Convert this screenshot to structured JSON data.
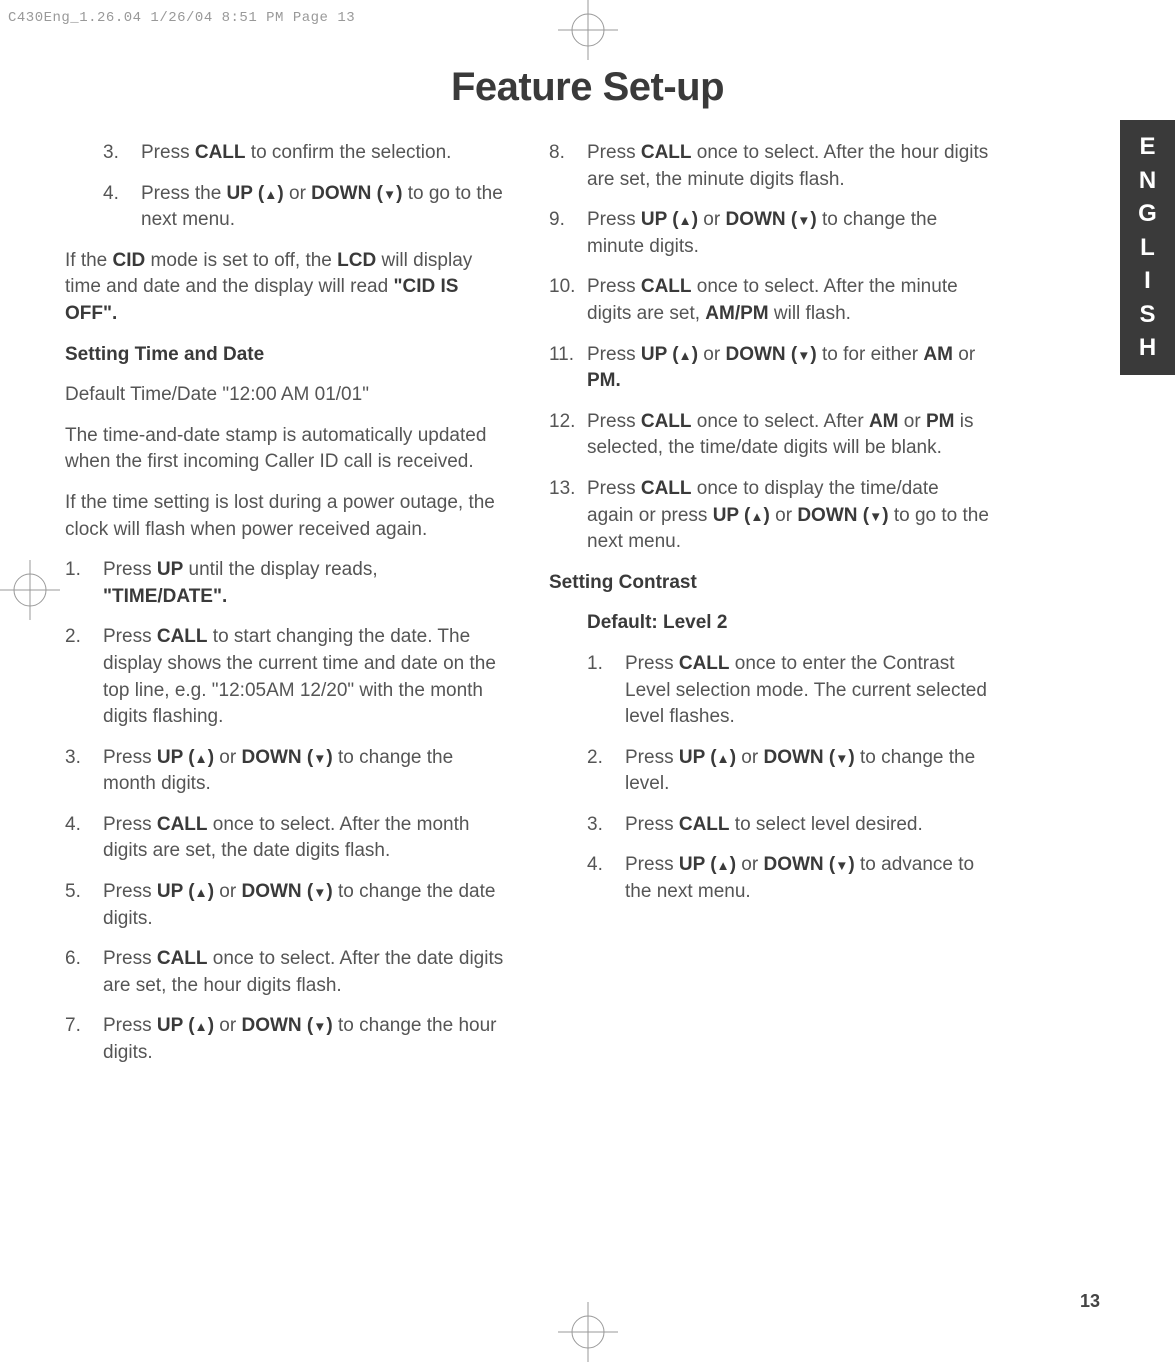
{
  "header_print": "C430Eng_1.26.04  1/26/04  8:51 PM  Page 13",
  "title": "Feature Set-up",
  "side_tab": [
    "E",
    "N",
    "G",
    "L",
    "I",
    "S",
    "H"
  ],
  "page_number": "13",
  "left": {
    "li3_num": "3.",
    "li3_a": "Press ",
    "li3_b": "CALL",
    "li3_c": " to confirm the selection.",
    "li4_num": "4.",
    "li4_a": "Press the ",
    "li4_b": "UP (",
    "li4_c": ")",
    "li4_d": " or ",
    "li4_e": "DOWN (",
    "li4_f": ")",
    "li4_g": " to go to the next menu.",
    "p1_a": "If the ",
    "p1_b": "CID",
    "p1_c": " mode is set to off, the ",
    "p1_d": "LCD",
    "p1_e": " will display time and date and the display will read ",
    "p1_f": "\"CID IS OFF\".",
    "h1": "Setting Time and Date",
    "p2": "Default Time/Date \"12:00 AM 01/01\"",
    "p3": "The time-and-date stamp is automatically updated when the first incoming Caller ID call is received.",
    "p4": "If the time setting is lost during a power outage, the clock will flash when power received  again.",
    "s1_num": "1.",
    "s1_a": "Press ",
    "s1_b": "UP",
    "s1_c": " until the display reads, ",
    "s1_d": "\"TIME/DATE\".",
    "s2_num": "2.",
    "s2_a": "Press ",
    "s2_b": "CALL",
    "s2_c": " to start changing the date. The display shows the current time and date on the top line, e.g. \"12:05AM 12/20\" with the month digits flashing.",
    "s3_num": "3.",
    "s3_a": "Press ",
    "s3_b": "UP (",
    "s3_c": ")",
    "s3_d": " or ",
    "s3_e": "DOWN (",
    "s3_f": ")",
    "s3_g": " to change the  month digits.",
    "s4_num": "4.",
    "s4_a": "Press ",
    "s4_b": "CALL",
    "s4_c": " once to select. After the month digits are set, the date digits flash.",
    "s5_num": "5.",
    "s5_a": "Press ",
    "s5_b": "UP (",
    "s5_c": ")",
    "s5_d": " or ",
    "s5_e": "DOWN (",
    "s5_f": ")",
    "s5_g": " to change the  date digits.",
    "s6_num": "6.",
    "s6_a": "Press ",
    "s6_b": "CALL",
    "s6_c": " once to select. After the date digits are set, the hour digits flash.",
    "s7_num": "7.",
    "s7_a": "Press ",
    "s7_b": "UP (",
    "s7_c": ")",
    "s7_d": " or ",
    "s7_e": "DOWN (",
    "s7_f": ")",
    "s7_g": " to change the hour digits."
  },
  "right": {
    "s8_num": "8.",
    "s8_a": "Press ",
    "s8_b": "CALL",
    "s8_c": " once to select. After the hour digits are set, the minute digits flash.",
    "s9_num": "9.",
    "s9_a": "Press ",
    "s9_b": "UP (",
    "s9_c": ")",
    "s9_d": " or ",
    "s9_e": "DOWN (",
    "s9_f": ")",
    "s9_g": " to change the  minute digits.",
    "s10_num": "10.",
    "s10_a": "Press ",
    "s10_b": "CALL",
    "s10_c": " once to select. After the minute digits are set, ",
    "s10_d": "AM/PM",
    "s10_e": " will flash.",
    "s11_num": "11.",
    "s11_a": "Press ",
    "s11_b": "UP (",
    "s11_c": ")",
    "s11_d": " or ",
    "s11_e": "DOWN (",
    "s11_f": ")",
    "s11_g": " to for either ",
    "s11_h": "AM",
    "s11_i": " or ",
    "s11_j": "PM.",
    "s12_num": "12.",
    "s12_a": "Press ",
    "s12_b": "CALL",
    "s12_c": " once to select. After ",
    "s12_d": "AM",
    "s12_e": " or ",
    "s12_f": "PM",
    "s12_g": " is selected, the time/date digits will be blank.",
    "s13_num": "13.",
    "s13_a": "Press ",
    "s13_b": "CALL",
    "s13_c": " once to display the time/date again or press ",
    "s13_d": "UP (",
    "s13_e": ")",
    "s13_f": " or ",
    "s13_g": "DOWN (",
    "s13_h": ")",
    "s13_i": " to go to the next menu.",
    "h2": "Setting Contrast",
    "h3": "Default: Level 2",
    "c1_num": "1.",
    "c1_a": "Press ",
    "c1_b": "CALL",
    "c1_c": " once to enter the Contrast Level selection mode.  The current selected level flashes.",
    "c2_num": "2.",
    "c2_a": "Press ",
    "c2_b": "UP (",
    "c2_c": ")",
    "c2_d": " or ",
    "c2_e": "DOWN (",
    "c2_f": ")",
    "c2_g": " to change the level.",
    "c3_num": "3.",
    "c3_a": "Press ",
    "c3_b": "CALL",
    "c3_c": " to select level desired.",
    "c4_num": "4.",
    "c4_a": "Press ",
    "c4_b": "UP (",
    "c4_c": ")",
    "c4_d": " or ",
    "c4_e": "DOWN (",
    "c4_f": ")",
    "c4_g": " to advance to the next menu."
  }
}
